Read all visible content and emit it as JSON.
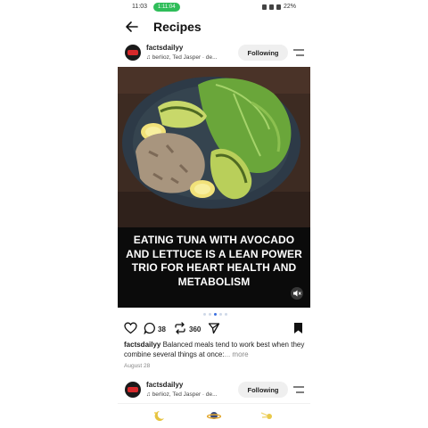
{
  "status_bar": {
    "time": "11:03",
    "call_label": "1:11:04",
    "battery": "22%"
  },
  "header": {
    "title": "Recipes"
  },
  "post": {
    "username": "factsdailyy",
    "music": "berlioz, Ted Jasper · de...",
    "follow_label": "Following",
    "overlay_text": "EATING TUNA WITH AVOCADO AND LETTUCE IS A LEAN POWER TRIO FOR HEART HEALTH AND METABOLISM",
    "comments": "38",
    "reposts": "360",
    "caption_user": "factsdailyy",
    "caption_text": " Balanced meals tend to work best when they combine several things at once:",
    "more_label": "... more",
    "date": "August 28"
  },
  "next_post": {
    "username": "factsdailyy",
    "music": "berlioz, Ted Jasper · de...",
    "follow_label": "Following"
  },
  "colors": {
    "call_pill": "#2fbd59",
    "active_dot": "#3b6fe0",
    "overlay_bg": "#0b0b0b"
  }
}
